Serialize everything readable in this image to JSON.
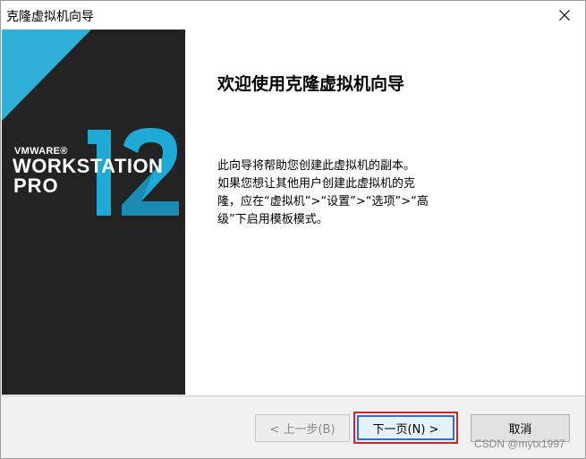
{
  "window": {
    "title": "克隆虚拟机向导"
  },
  "sidebar": {
    "brand_vmware": "VMWARE®",
    "brand_workstation": "WORKSTATION",
    "brand_pro": "PRO",
    "version_number": "12",
    "colors": {
      "background": "#232323",
      "accent": "#1fa9d6",
      "dark_accent": "#17799c"
    }
  },
  "content": {
    "title": "欢迎使用克隆虚拟机向导",
    "body_lines": [
      "此向导将帮助您创建此虚拟机的副本。",
      "如果您想让其他用户创建此虚拟机的克",
      "隆，应在“虚拟机”>“设置”>“选项”>“高",
      "级”下启用模板模式。"
    ]
  },
  "footer": {
    "prev_label": "< 上一步(B)",
    "next_label": "下一页(N) >",
    "cancel_label": "取消"
  },
  "watermark": "CSDN @mytx1997",
  "icons": {
    "close": "close-icon"
  }
}
